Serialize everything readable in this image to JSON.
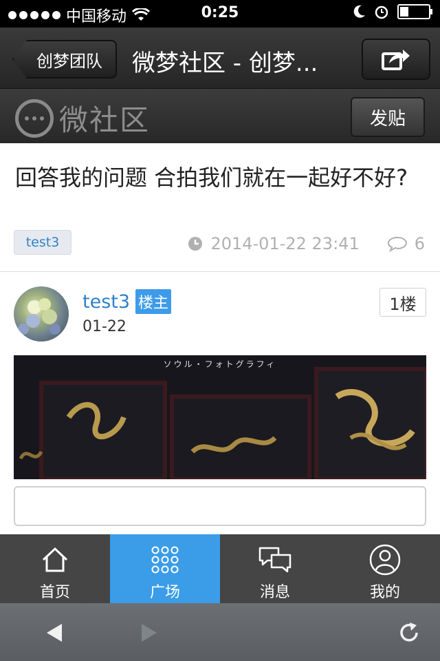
{
  "status_bar": {
    "carrier": "中国移动",
    "time": "0:25"
  },
  "nav": {
    "back_label": "创梦团队",
    "title": "微梦社区 - 创梦..."
  },
  "brand": {
    "logo_text": "微社区",
    "post_button": "发贴"
  },
  "post": {
    "title": "回答我的问题 合拍我们就在一起好不好?",
    "tag": "test3",
    "datetime": "2014-01-22 23:41",
    "comment_count": "6"
  },
  "first_reply": {
    "author": "test3",
    "owner_badge": "楼主",
    "date": "01-22",
    "floor": "1楼",
    "image_caption": "ソウル・フォトグラフィ"
  },
  "reply_input": {
    "placeholder": ""
  },
  "tabs": [
    {
      "label": "首页",
      "icon": "home-icon",
      "active": false
    },
    {
      "label": "广场",
      "icon": "grid-icon",
      "active": true
    },
    {
      "label": "消息",
      "icon": "messages-icon",
      "active": false
    },
    {
      "label": "我的",
      "icon": "profile-icon",
      "active": false
    }
  ],
  "colors": {
    "accent": "#3b9ce8",
    "link": "#2f82c8",
    "tab_bar": "#454545"
  }
}
